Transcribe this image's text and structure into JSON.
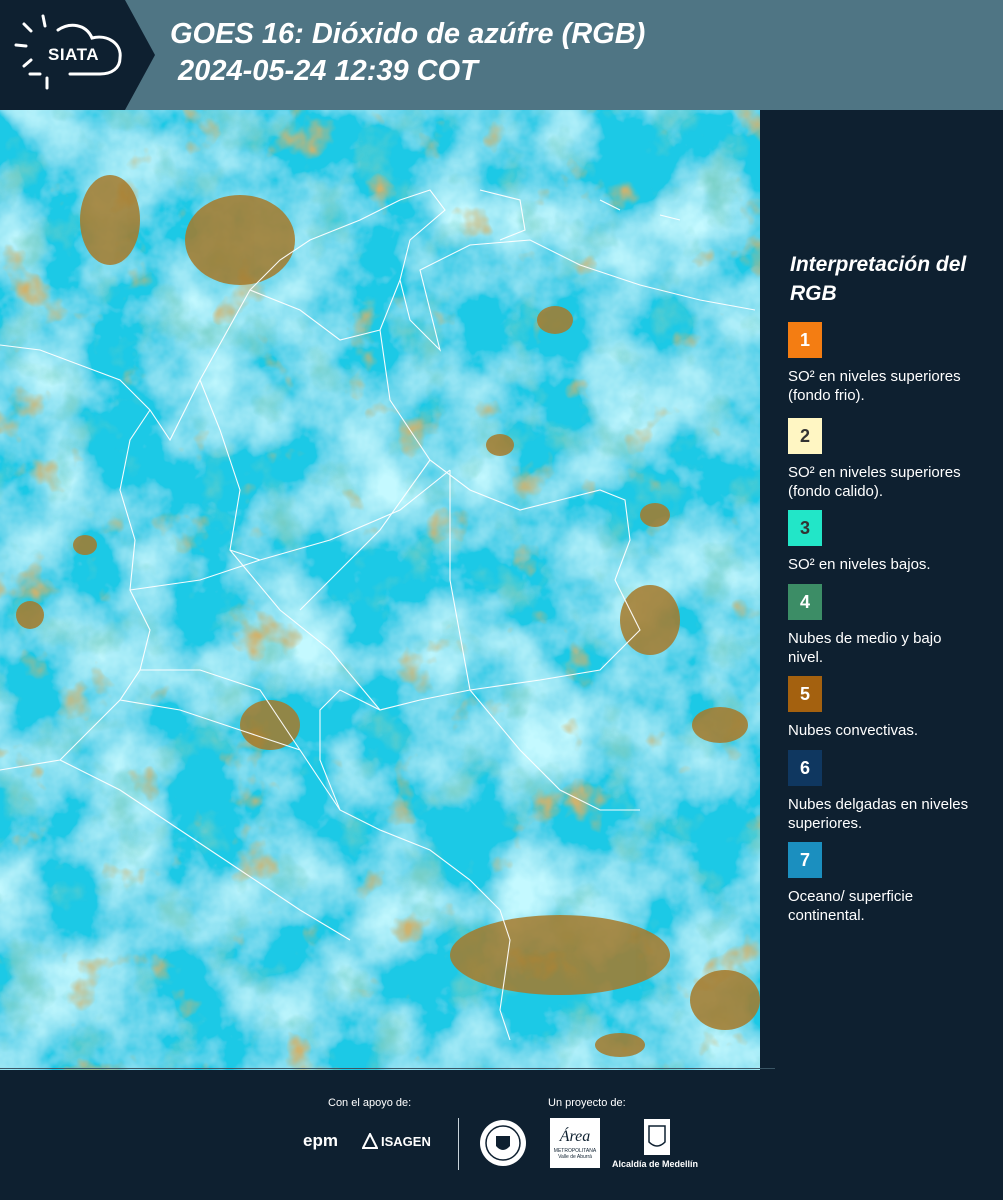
{
  "header": {
    "logo_text": "SIATA",
    "title": "GOES 16: Dióxido de azúfre (RGB)\n 2024-05-24 12:39 COT"
  },
  "legend": {
    "title": "Interpretación del RGB",
    "items": [
      {
        "number": "1",
        "color": "#f47d12",
        "text": "SO² en niveles superiores (fondo frio)."
      },
      {
        "number": "2",
        "color": "#fff6c3",
        "text": "SO² en niveles superiores (fondo calido)."
      },
      {
        "number": "3",
        "color": "#22e6c8",
        "text": "SO² en niveles bajos."
      },
      {
        "number": "4",
        "color": "#3c8d66",
        "text": "Nubes de medio y bajo nivel."
      },
      {
        "number": "5",
        "color": "#a4610f",
        "text": "Nubes convectivas."
      },
      {
        "number": "6",
        "color": "#0f3760",
        "text": "Nubes delgadas en niveles superiores."
      },
      {
        "number": "7",
        "color": "#1b8fbf",
        "text": "Oceano/ superficie continental."
      }
    ]
  },
  "footer": {
    "support_label": "Con el apoyo de:",
    "project_label": "Un proyecto de:",
    "epm": "epm",
    "isagen": "ISAGEN",
    "area_logo_text": "Área",
    "area_sub1": "METROPOLITANA",
    "area_sub2": "Valle de Aburrá",
    "alcaldia": "Alcaldía de Medellín"
  }
}
